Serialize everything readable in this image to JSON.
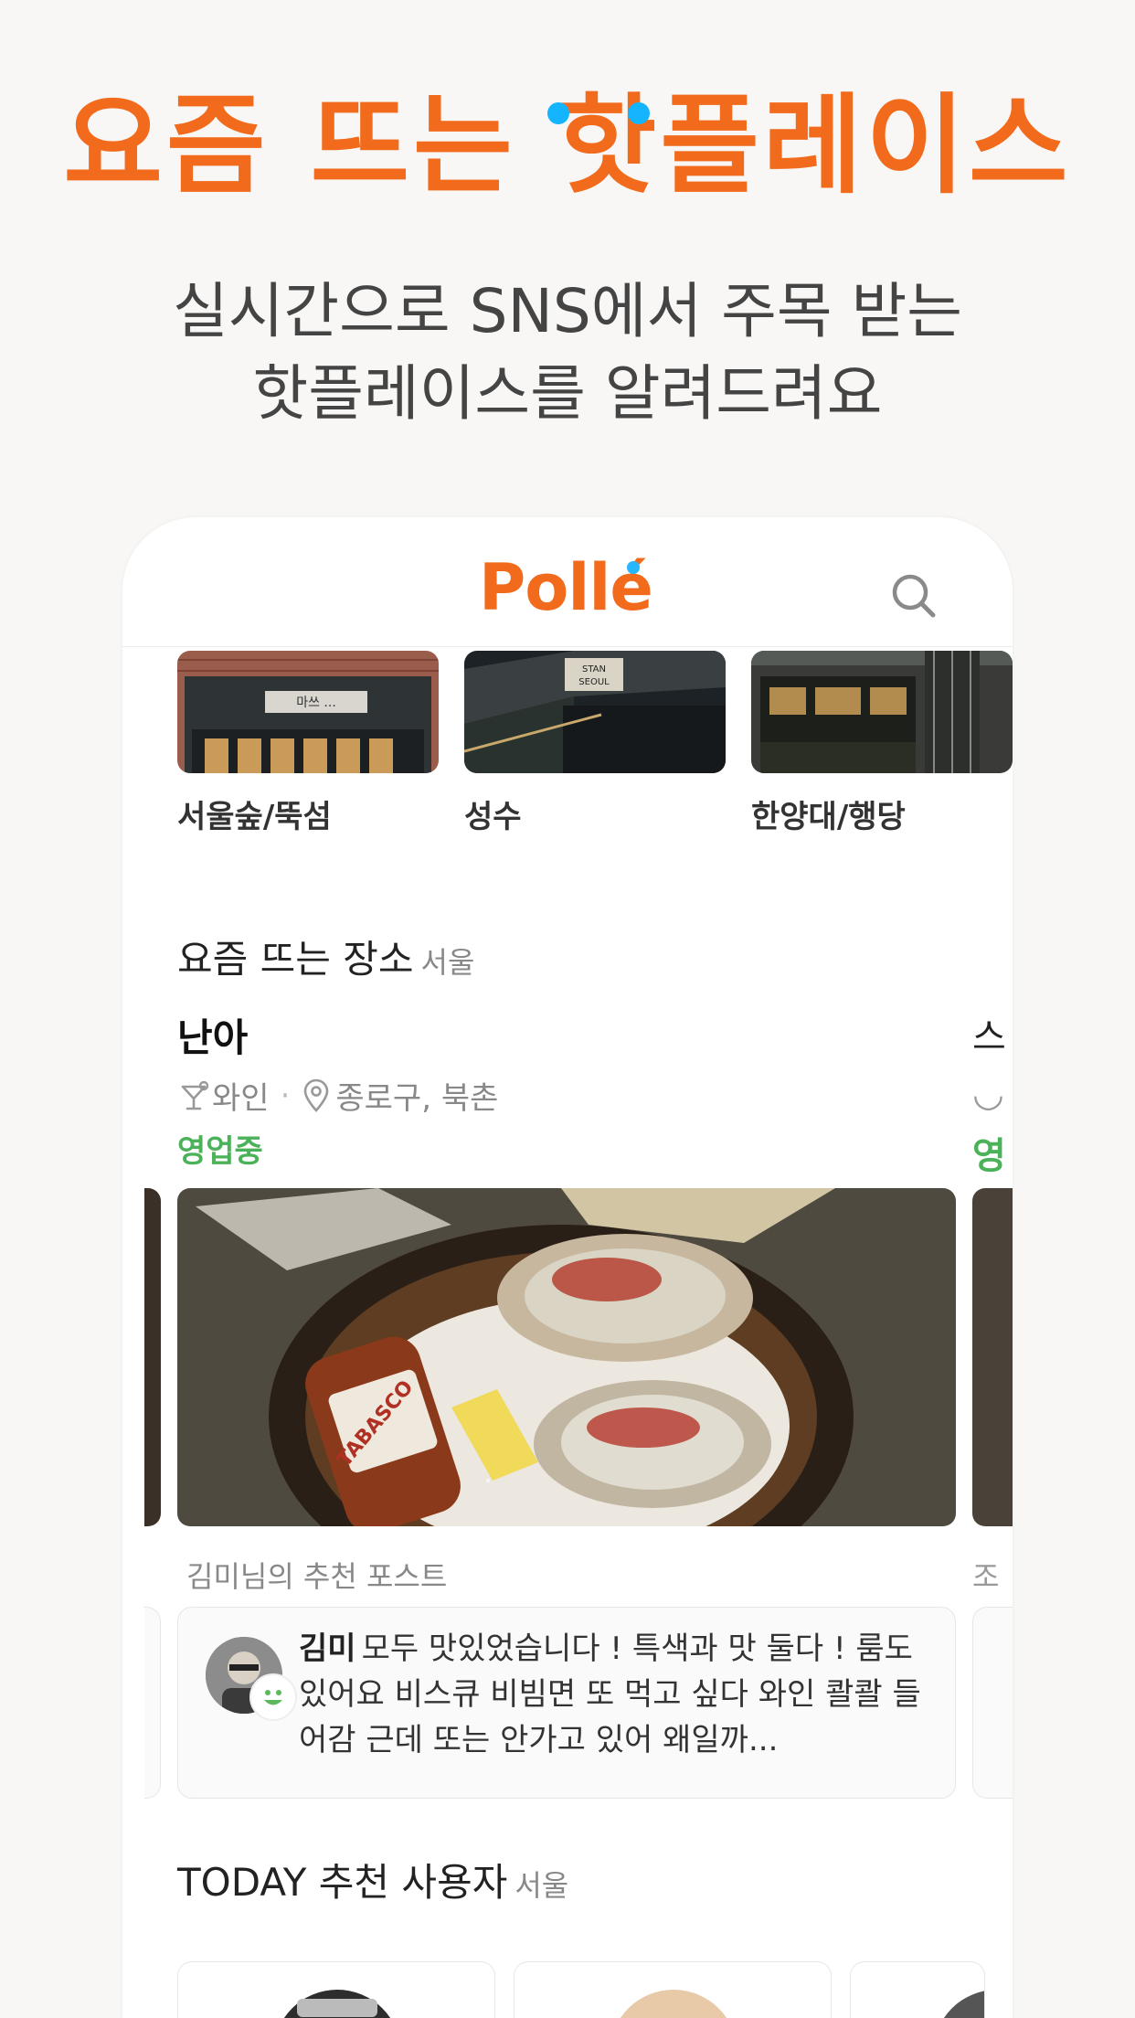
{
  "promo": {
    "title": "요즘 뜨는 핫플레이스",
    "subtitle_line1": "실시간으로 SNS에서 주목 받는",
    "subtitle_line2": "핫플레이스를 알려드려요"
  },
  "app": {
    "brand": "Pollé",
    "search_icon": "search-icon"
  },
  "areas": [
    {
      "label": "서울숲/뚝섬",
      "sign_text": "마쓰 ..."
    },
    {
      "label": "성수",
      "sign_text": "STAN SEOUL"
    },
    {
      "label": "한양대/행당",
      "sign_text": ""
    }
  ],
  "trending": {
    "heading": "요즘 뜨는 장소",
    "heading_region": "서울",
    "place": {
      "name": "난아",
      "category": "와인",
      "category_icon": "cocktail-icon",
      "location": "종로구, 북촌",
      "location_icon": "pin-icon",
      "status": "영업중"
    },
    "next_card_peek": {
      "name": "스",
      "status": "영",
      "caption": "조"
    },
    "post_caption": "김미님의 추천 포스트",
    "post": {
      "author": "김미",
      "text": "모두 맛있었습니다 ! 특색과 맛 둘다 ! 룸도 있어요  비스큐 비빔면 또 먹고 싶다 와인 콸콸 들어감    근데 또는 안가고 있어 왜일까..."
    }
  },
  "today_users": {
    "heading": "TODAY 추천 사용자",
    "heading_region": "서울"
  },
  "colors": {
    "accent": "#f26a1b",
    "dot": "#15b4ff",
    "open_status": "#4cb25a",
    "background": "#f8f7f5"
  }
}
